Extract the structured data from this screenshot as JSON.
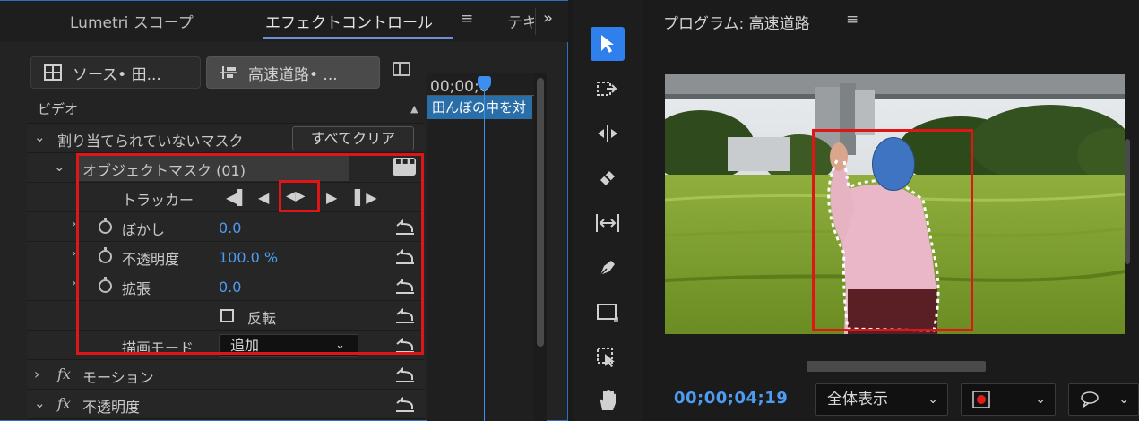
{
  "effect_controls": {
    "tabs": [
      {
        "label": "Lumetri スコープ"
      },
      {
        "label": "エフェクトコントロール"
      },
      {
        "label": "テキ"
      }
    ],
    "menu_glyph": "≡",
    "overflow_glyph": "»",
    "source_clip": "ソース• 田...",
    "sequence_clip": "高速道路• ...",
    "section_video": "ビデオ",
    "unassigned_mask": "割り当てられていないマスク",
    "clear_all": "すべてクリア",
    "object_mask": "オブジェクトマスク (01)",
    "tracker": "トラッカー",
    "feather": {
      "label": "ぼかし",
      "value": "0.0"
    },
    "opacity_mask": {
      "label": "不透明度",
      "value": "100.0 %"
    },
    "expansion": {
      "label": "拡張",
      "value": "0.0"
    },
    "invert": "反転",
    "blend_mode": {
      "label": "描画モード",
      "value": "追加"
    },
    "motion": "モーション",
    "opacity": "不透明度",
    "fx_glyph": "fx"
  },
  "timeline": {
    "timecode": "00;00;0",
    "clip_label": "田んぼの中を対"
  },
  "program_monitor": {
    "title": "プログラム: 高速道路",
    "menu_glyph": "≡",
    "timecode": "00;00;04;19",
    "zoom": "全体表示"
  },
  "colors": {
    "accent": "#2f80ed",
    "value_blue": "#4d9cf2",
    "highlight_red": "#e01515",
    "clip_blue": "#2a6ea8"
  }
}
